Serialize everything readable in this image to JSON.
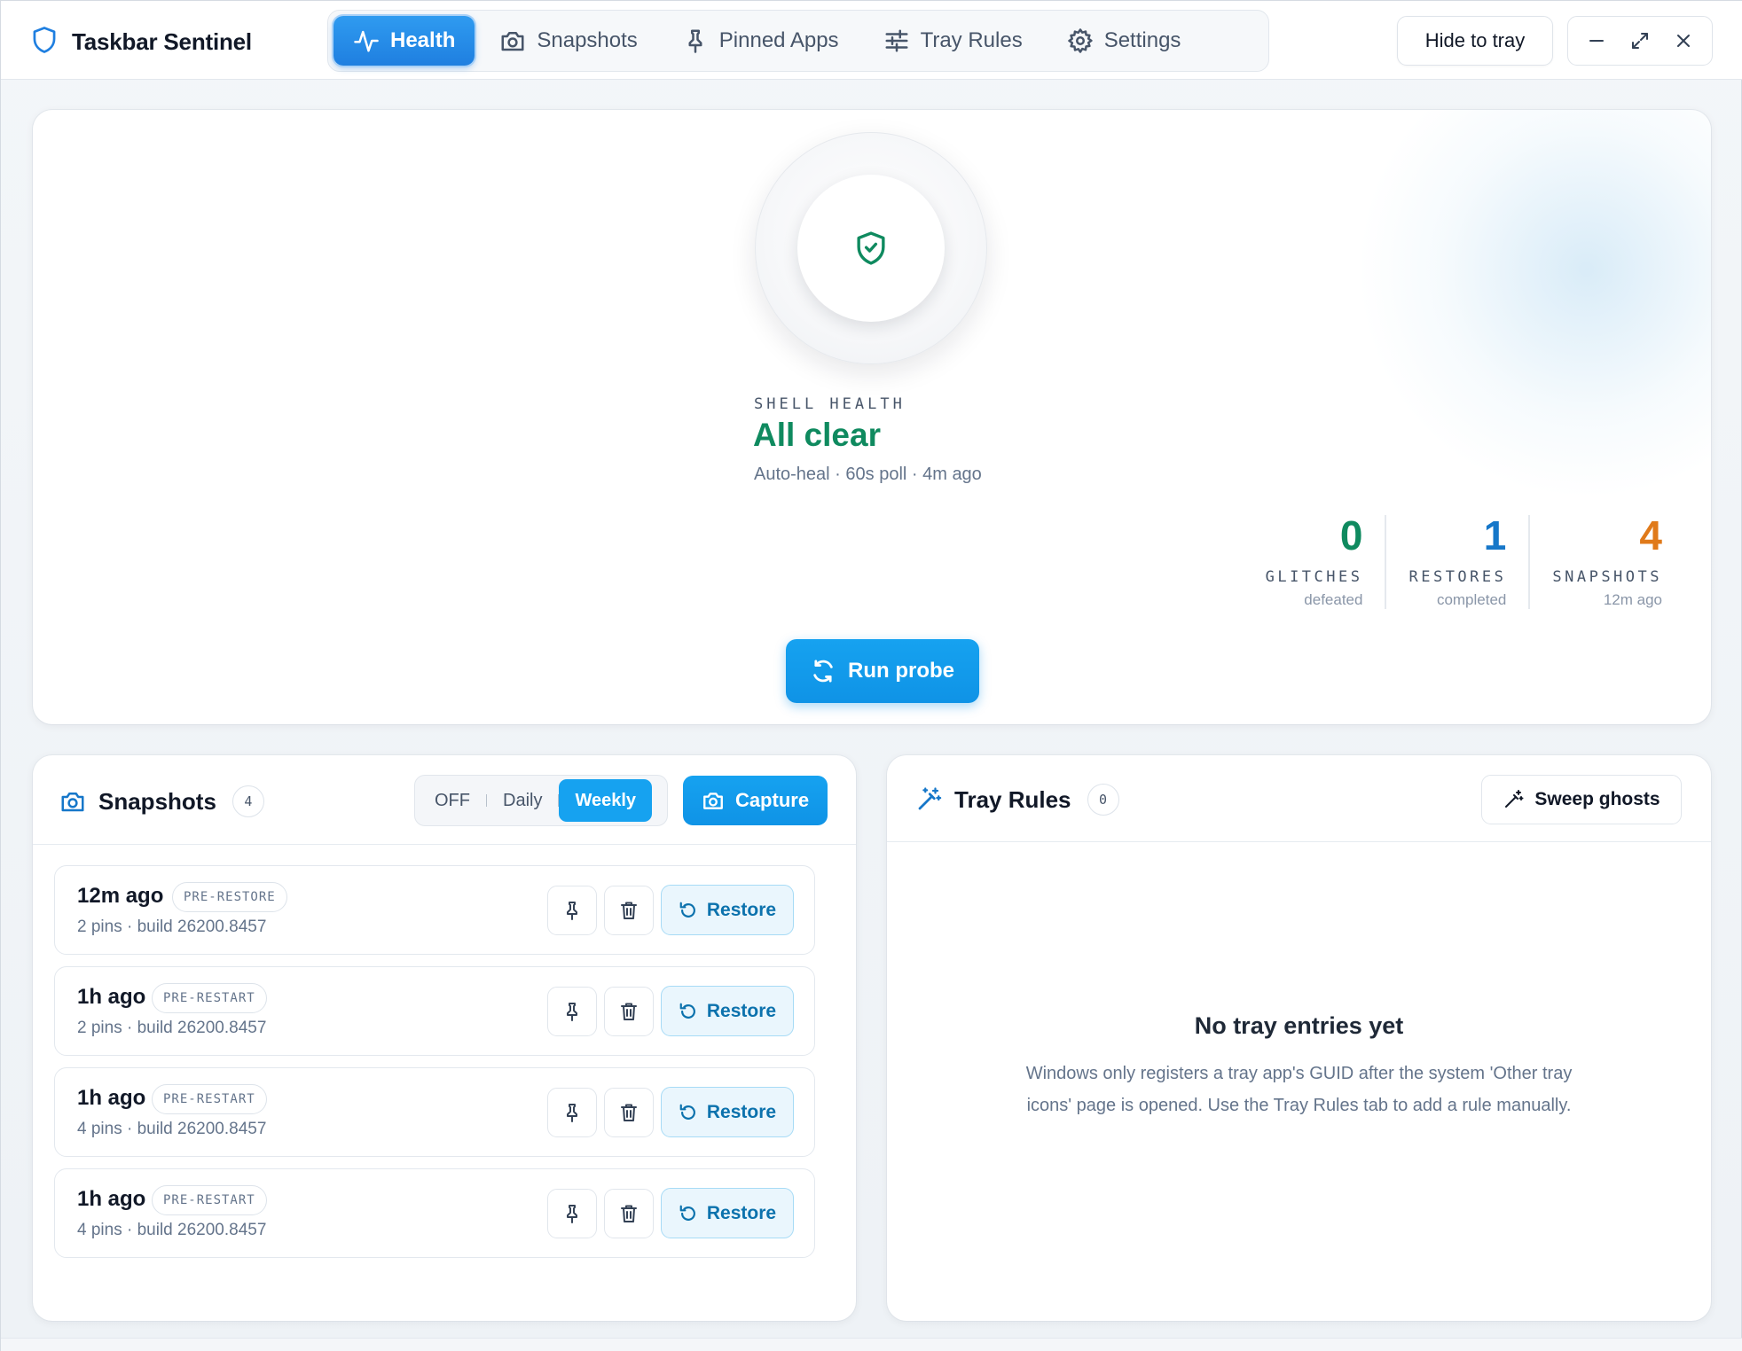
{
  "app": {
    "title": "Taskbar Sentinel"
  },
  "nav": {
    "tabs": [
      {
        "label": "Health",
        "icon": "activity-icon",
        "active": true
      },
      {
        "label": "Snapshots",
        "icon": "camera-icon",
        "active": false
      },
      {
        "label": "Pinned Apps",
        "icon": "pin-icon",
        "active": false
      },
      {
        "label": "Tray Rules",
        "icon": "sliders-icon",
        "active": false
      },
      {
        "label": "Settings",
        "icon": "gear-icon",
        "active": false
      }
    ]
  },
  "toolbar": {
    "hide_to_tray": "Hide to tray"
  },
  "health": {
    "label": "SHELL HEALTH",
    "status": "All clear",
    "subtitle": "Auto-heal · 60s poll · 4m ago",
    "status_color": "#0f8a5f",
    "stats": [
      {
        "value": "0",
        "label": "GLITCHES",
        "sub": "defeated",
        "color": "#0f8a5f"
      },
      {
        "value": "1",
        "label": "RESTORES",
        "sub": "completed",
        "color": "#1677c9"
      },
      {
        "value": "4",
        "label": "SNAPSHOTS",
        "sub": "12m ago",
        "color": "#e07a1a"
      }
    ],
    "run_probe": "Run probe"
  },
  "snapshots": {
    "title": "Snapshots",
    "count": "4",
    "schedule": {
      "options": [
        "OFF",
        "Daily",
        "Weekly"
      ],
      "selected": "Weekly"
    },
    "capture": "Capture",
    "items": [
      {
        "when": "12m ago",
        "tag": "PRE-RESTORE",
        "meta": "2 pins · build 26200.8457",
        "restore": "Restore"
      },
      {
        "when": "1h ago",
        "tag": "PRE-RESTART",
        "meta": "2 pins · build 26200.8457",
        "restore": "Restore"
      },
      {
        "when": "1h ago",
        "tag": "PRE-RESTART",
        "meta": "4 pins · build 26200.8457",
        "restore": "Restore"
      },
      {
        "when": "1h ago",
        "tag": "PRE-RESTART",
        "meta": "4 pins · build 26200.8457",
        "restore": "Restore"
      }
    ]
  },
  "tray_rules": {
    "title": "Tray Rules",
    "count": "0",
    "sweep": "Sweep ghosts",
    "empty_title": "No tray entries yet",
    "empty_desc": "Windows only registers a tray app's GUID after the system 'Other tray icons' page is opened. Use the Tray Rules tab to add a rule manually."
  },
  "colors": {
    "accent": "#16a2f0",
    "tab_active": "#1f7fe0"
  }
}
